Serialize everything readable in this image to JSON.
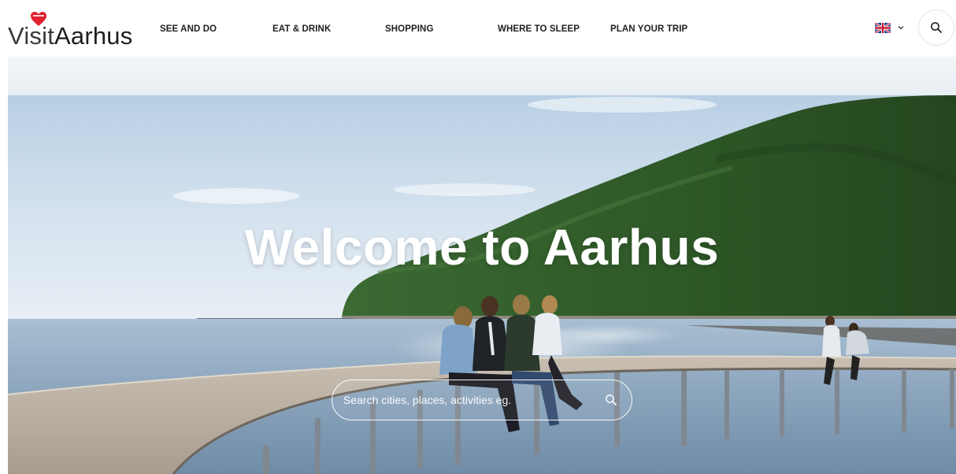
{
  "brand": {
    "logo_light": "Visit",
    "logo_bold": "Aarhus",
    "heart_color": "#e0202e"
  },
  "nav": {
    "items": [
      {
        "label": "SEE AND DO"
      },
      {
        "label": "EAT & DRINK"
      },
      {
        "label": "SHOPPING"
      },
      {
        "label": "WHERE TO SLEEP"
      },
      {
        "label": "PLAN YOUR TRIP"
      }
    ]
  },
  "language": {
    "icon": "uk-flag-icon",
    "dropdown_icon": "chevron-down-icon"
  },
  "header_search": {
    "icon": "search-icon"
  },
  "hero": {
    "title": "Welcome to Aarhus",
    "search_placeholder": "Search cities, places, activities eg.",
    "search_icon": "search-icon"
  },
  "colors": {
    "text_dark": "#1f1f1f",
    "sky": "#c9dbeb",
    "sea": "#8fa9c0",
    "forest": "#2f5a2a",
    "boardwalk": "#b8aea0"
  }
}
